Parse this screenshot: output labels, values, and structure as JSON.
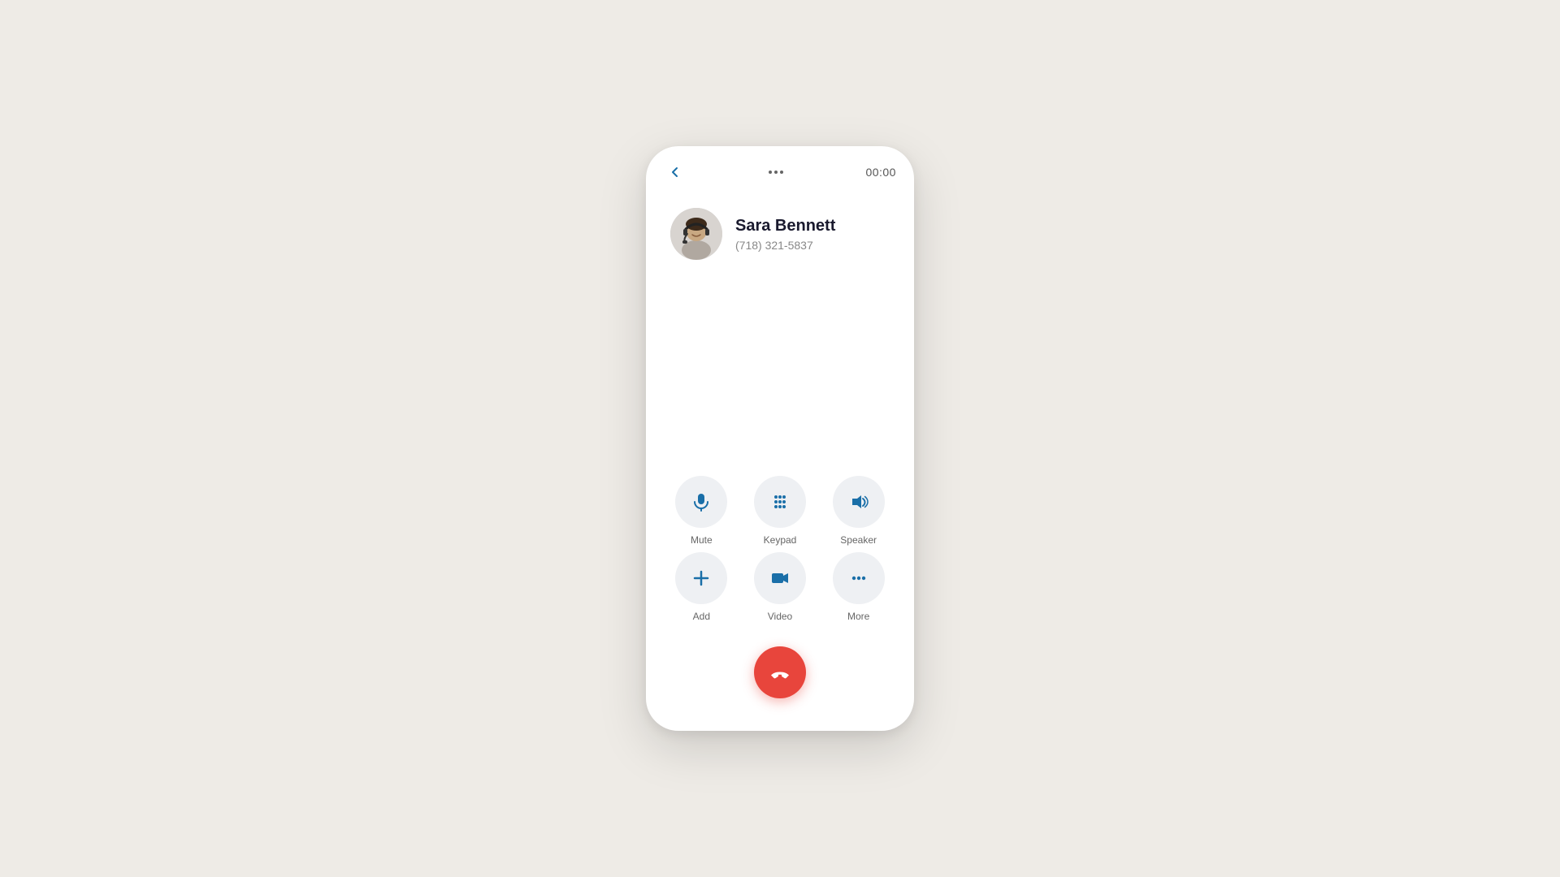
{
  "header": {
    "timer": "00:00"
  },
  "contact": {
    "name": "Sara Bennett",
    "phone": "(718) 321-5837"
  },
  "controls": {
    "row1": [
      {
        "id": "mute",
        "label": "Mute"
      },
      {
        "id": "keypad",
        "label": "Keypad"
      },
      {
        "id": "speaker",
        "label": "Speaker"
      }
    ],
    "row2": [
      {
        "id": "add",
        "label": "Add"
      },
      {
        "id": "video",
        "label": "Video"
      },
      {
        "id": "more",
        "label": "More"
      }
    ]
  },
  "endCall": {
    "label": "End Call"
  },
  "colors": {
    "iconBlue": "#1a6fa8",
    "buttonBg": "#eef0f3",
    "endCallRed": "#e8453c"
  }
}
